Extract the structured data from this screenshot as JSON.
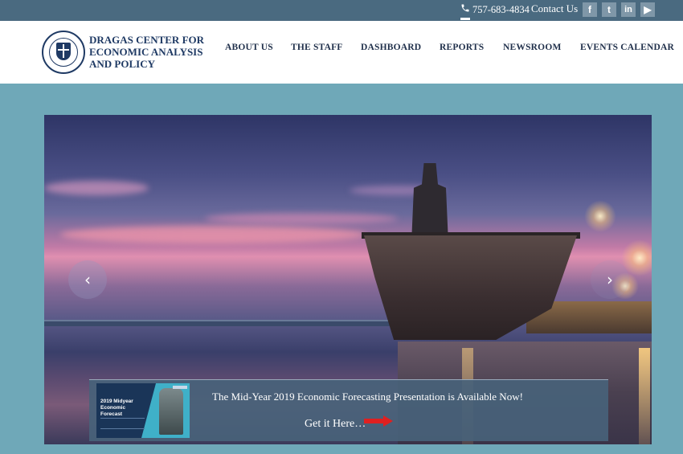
{
  "topbar": {
    "phone": "757-683-4834",
    "contact_label": "Contact Us",
    "social": {
      "facebook": "f",
      "twitter": "t",
      "linkedin": "in",
      "youtube": "▶"
    }
  },
  "header": {
    "logo_line1": "DRAGAS CENTER FOR",
    "logo_line2": "ECONOMIC ANALYSIS",
    "logo_line3": "AND POLICY",
    "nav": [
      {
        "label": "ABOUT US"
      },
      {
        "label": "THE STAFF"
      },
      {
        "label": "DASHBOARD"
      },
      {
        "label": "REPORTS"
      },
      {
        "label": "NEWSROOM"
      },
      {
        "label": "EVENTS CALENDAR"
      }
    ]
  },
  "slider": {
    "prev_icon": "‹",
    "next_icon": "›"
  },
  "banner": {
    "thumb_title": "2019 Midyear Economic Forecast",
    "headline": "The Mid-Year 2019 Economic Forecasting Presentation is Available Now!",
    "cta": "Get it Here…"
  },
  "colors": {
    "topbar": "#4a6a80",
    "navy": "#1f3a64",
    "page_bg": "#6fa8b8",
    "arrow": "#e02020"
  }
}
